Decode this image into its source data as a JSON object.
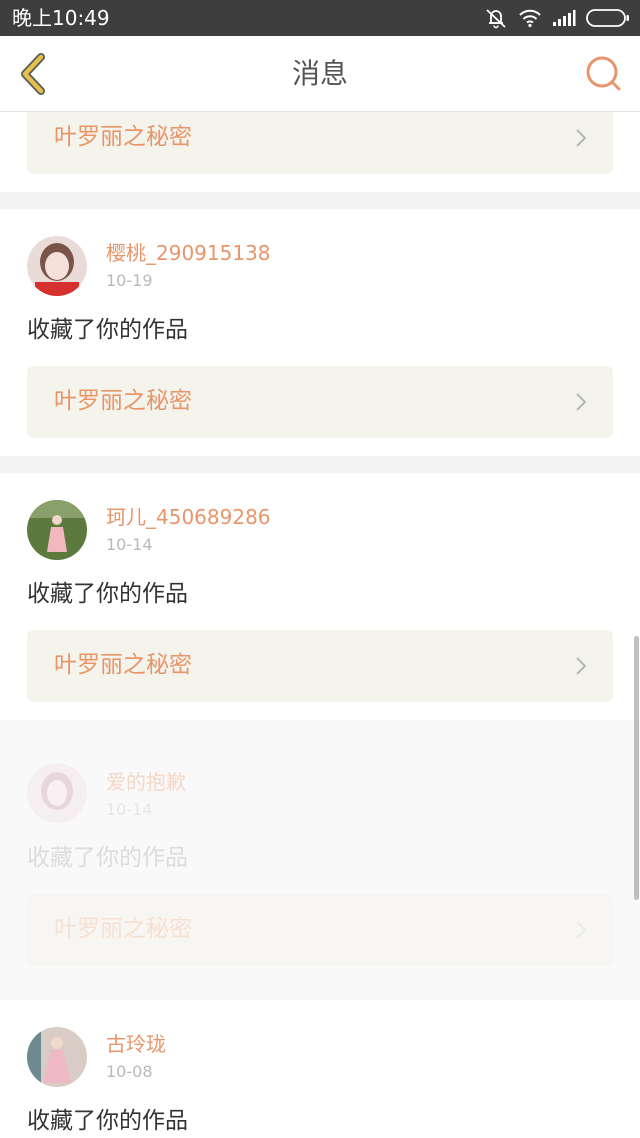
{
  "status_bar": {
    "time": "晚上10:49",
    "icons": [
      "mute-icon",
      "wifi-icon",
      "signal-icon",
      "battery-icon"
    ]
  },
  "nav": {
    "title": "消息",
    "back_icon": "back-chevron-icon",
    "search_icon": "search-icon"
  },
  "colors": {
    "accent": "#e8956a",
    "back_icon": "#e6c04a",
    "work_bg": "#f4f3ec"
  },
  "notifications": [
    {
      "user": "",
      "date": "",
      "action": "",
      "work_title": "叶罗丽之秘密"
    },
    {
      "user": "樱桃_290915138",
      "date": "10-19",
      "action": "收藏了你的作品",
      "work_title": "叶罗丽之秘密"
    },
    {
      "user": "珂儿_450689286",
      "date": "10-14",
      "action": "收藏了你的作品",
      "work_title": "叶罗丽之秘密"
    },
    {
      "user": "爱的抱歉",
      "date": "10-14",
      "action": "收藏了你的作品",
      "work_title": "叶罗丽之秘密"
    },
    {
      "user": "古玲珑",
      "date": "10-08",
      "action": "收藏了你的作品",
      "work_title": ""
    }
  ]
}
